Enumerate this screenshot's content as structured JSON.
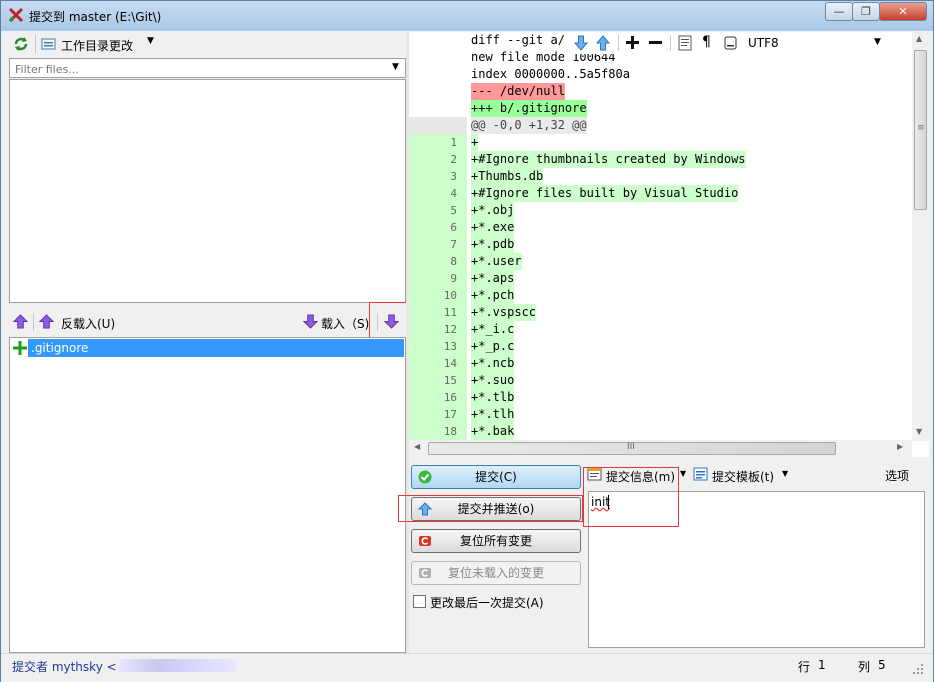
{
  "window": {
    "title": "提交到 master (E:\\Git\\)",
    "controls": [
      "—",
      "❐",
      "✕"
    ]
  },
  "left_top": {
    "dropdown_label": "工作目录更改",
    "filter_placeholder": "Filter files..."
  },
  "stage_bar": {
    "unstage_label": "反载入(U)",
    "stage_label": "载入（S)"
  },
  "staged_files": [
    {
      "name": ".gitignore"
    }
  ],
  "diff_toolbar": {
    "encoding": "UTF8"
  },
  "diff": {
    "header_lines": [
      "diff --git a/",
      "new file mode 100644",
      "index 0000000..5a5f80a",
      "--- /dev/null",
      "+++ b/.gitignore",
      "@@ -0,0 +1,32 @@"
    ],
    "lines": [
      {
        "n": "1",
        "text": "+"
      },
      {
        "n": "2",
        "text": "+#Ignore thumbnails created by Windows"
      },
      {
        "n": "3",
        "text": "+Thumbs.db"
      },
      {
        "n": "4",
        "text": "+#Ignore files built by Visual Studio"
      },
      {
        "n": "5",
        "text": "+*.obj"
      },
      {
        "n": "6",
        "text": "+*.exe"
      },
      {
        "n": "7",
        "text": "+*.pdb"
      },
      {
        "n": "8",
        "text": "+*.user"
      },
      {
        "n": "9",
        "text": "+*.aps"
      },
      {
        "n": "10",
        "text": "+*.pch"
      },
      {
        "n": "11",
        "text": "+*.vspscc"
      },
      {
        "n": "12",
        "text": "+*_i.c"
      },
      {
        "n": "13",
        "text": "+*_p.c"
      },
      {
        "n": "14",
        "text": "+*.ncb"
      },
      {
        "n": "15",
        "text": "+*.suo"
      },
      {
        "n": "16",
        "text": "+*.tlb"
      },
      {
        "n": "17",
        "text": "+*.tlh"
      },
      {
        "n": "18",
        "text": "+*.bak"
      }
    ],
    "hscroll_grip": "III"
  },
  "actions": {
    "commit": "提交(C)",
    "commit_push": "提交并推送(o)",
    "reset_all": "复位所有变更",
    "reset_unstaged": "复位未载入的变更",
    "amend": "更改最后一次提交(A)"
  },
  "message_toolbar": {
    "commit_message": "提交信息(m)",
    "commit_template": "提交模板(t)",
    "options": "选项"
  },
  "message": {
    "text": "init"
  },
  "statusbar": {
    "committer": "提交者 mythsky <",
    "line_label": "行",
    "line_value": "1",
    "col_label": "列",
    "col_value": "5"
  },
  "colors": {
    "added_bg": "#ccffcc",
    "removed_bg": "#ff9999",
    "selected_bg": "#3399ff",
    "highlight_box": "#e03a3a"
  }
}
